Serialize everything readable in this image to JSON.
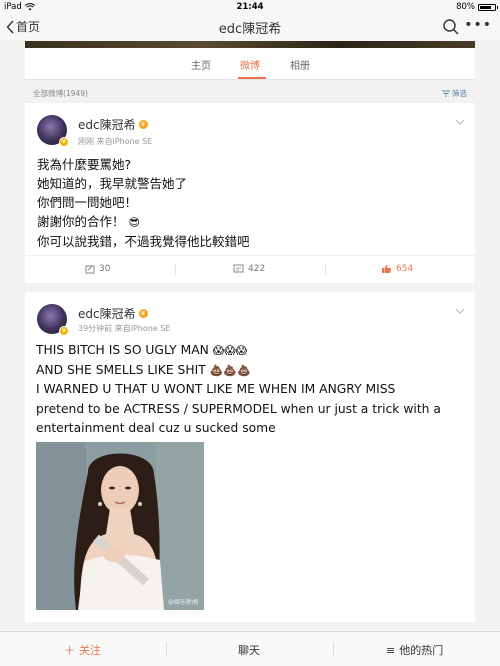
{
  "status_bar": {
    "device": "iPad",
    "time": "21:44",
    "battery": "80%",
    "battery_level": 0.8
  },
  "nav": {
    "back_label": "首页",
    "title": "edc陳冠希"
  },
  "tabs": [
    {
      "label": "主页"
    },
    {
      "label": "微博"
    },
    {
      "label": "相册"
    }
  ],
  "filter_row": {
    "count_label": "全部微博(1949)",
    "filter_label": "筛选"
  },
  "posts": [
    {
      "username": "edc陳冠希",
      "meta": "刚刚  来自iPhone SE",
      "lines": [
        "我為什麼要罵她?",
        "她知道的，我早就警告她了",
        "你們問一問她吧！",
        "謝謝你的合作！",
        "你可以說我錯，不過我覺得他比較錯吧"
      ],
      "emoji_line4": "😎",
      "reposts": "30",
      "comments": "422",
      "likes": "654"
    },
    {
      "username": "edc陳冠希",
      "meta": "39分钟前  来自iPhone SE",
      "lines": [
        "THIS BITCH IS SO UGLY MAN",
        "AND SHE SMELLS LIKE SHIT",
        "I WARNED U THAT U WONT LIKE ME WHEN IM ANGRY MISS",
        "pretend to be ACTRESS / SUPERMODEL when ur just a trick with a",
        "entertainment deal cuz u sucked some"
      ],
      "emoji_line1": "😱😱😱",
      "emoji_line2": "💩💩💩",
      "watermark": "@娱乐新闻"
    }
  ],
  "bottom_bar": {
    "follow": "关注",
    "chat": "聊天",
    "hot": "他的热门"
  },
  "colors": {
    "accent": "#eb7350",
    "link": "#5a7fa8"
  }
}
